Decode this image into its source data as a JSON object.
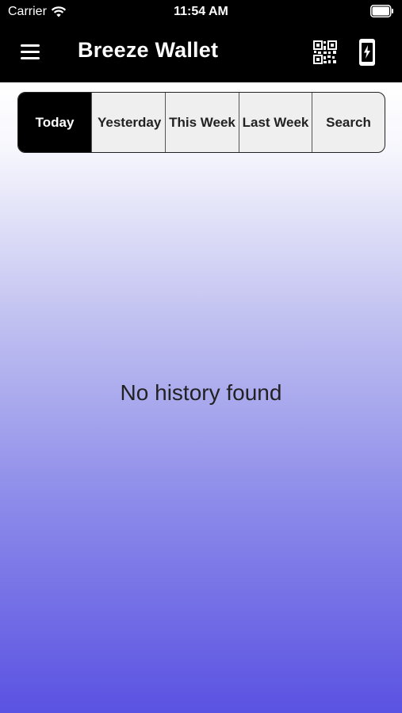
{
  "status_bar": {
    "carrier": "Carrier",
    "time": "11:54 AM",
    "wifi_icon": "wifi-icon",
    "battery_icon": "battery-icon"
  },
  "app_bar": {
    "title": "Breeze Wallet",
    "menu_icon": "hamburger-menu-icon",
    "qr_icon": "qr-code-icon",
    "device_icon": "phone-charge-icon"
  },
  "tabs": [
    {
      "label": "Today",
      "active": true
    },
    {
      "label": "Yesterday",
      "active": false
    },
    {
      "label": "This Week",
      "active": false
    },
    {
      "label": "Last Week",
      "active": false
    },
    {
      "label": "Search",
      "active": false
    }
  ],
  "main": {
    "empty_message": "No history found"
  },
  "colors": {
    "header_bg": "#000000",
    "active_tab_bg": "#000000",
    "tab_bg": "#f0efef",
    "gradient_bottom": "#5a52e2"
  }
}
